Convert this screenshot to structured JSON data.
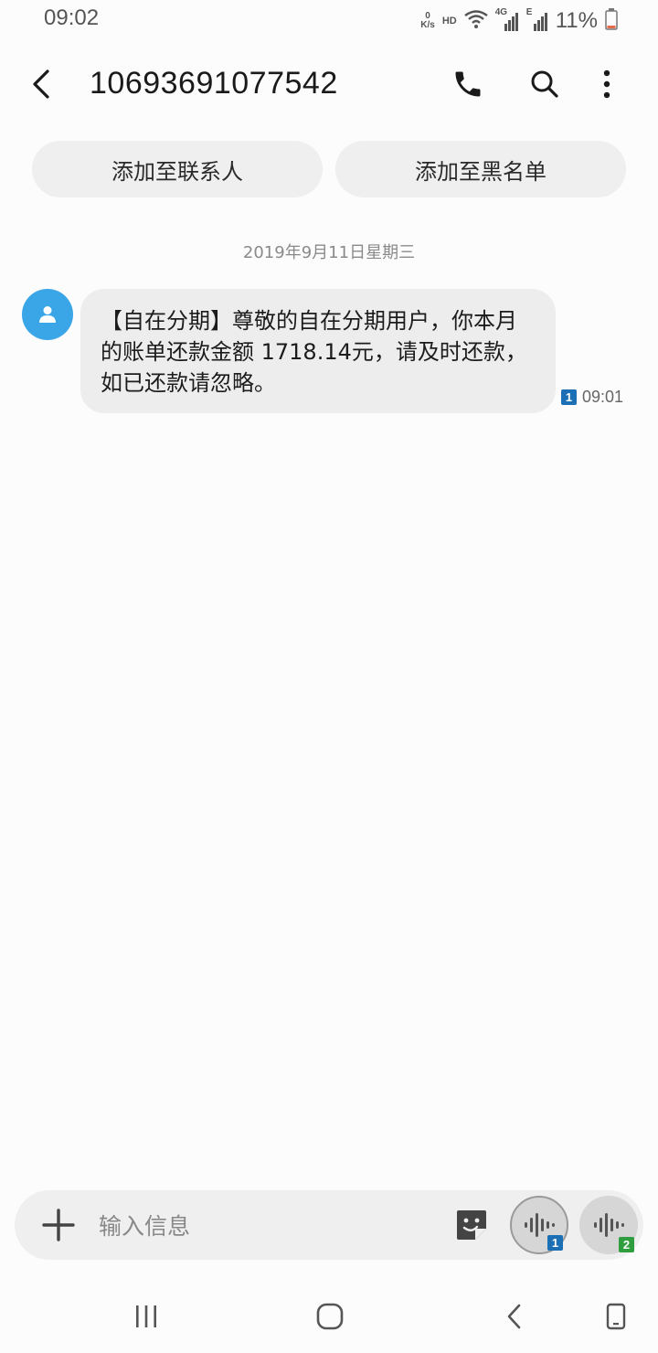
{
  "status_bar": {
    "time": "09:02",
    "net_speed_value": "0",
    "net_speed_unit": "K/s",
    "hd": "HD",
    "network_4g": "4G",
    "network_e": "E",
    "battery": "11%"
  },
  "header": {
    "title": "10693691077542"
  },
  "actions": {
    "add_contact": "添加至联系人",
    "add_blocklist": "添加至黑名单"
  },
  "conversation": {
    "date": "2019年9月11日星期三",
    "messages": [
      {
        "text": "【自在分期】尊敬的自在分期用户，你本月的账单还款金额 1718.14元，请及时还款，如已还款请忽略。",
        "sim": "1",
        "time": "09:01"
      }
    ]
  },
  "composer": {
    "placeholder": "输入信息",
    "voice_sim1": "1",
    "voice_sim2": "2"
  },
  "colors": {
    "avatar": "#3aa6e8",
    "sim1_badge": "#1a6fb5",
    "sim2_badge": "#2e9e3e"
  }
}
